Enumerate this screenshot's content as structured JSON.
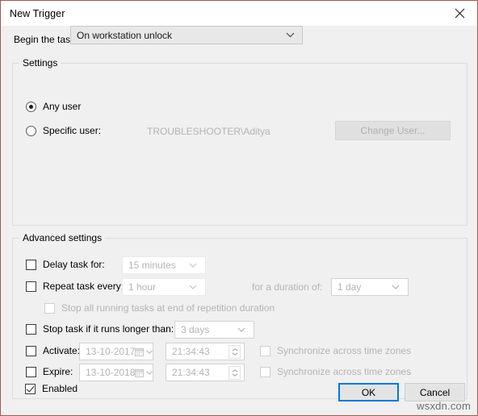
{
  "window": {
    "title": "New Trigger",
    "close_icon": "close-icon",
    "border_color": "#a3584f",
    "background": "#f0f0f0"
  },
  "begin": {
    "label": "Begin the task:",
    "value": "On workstation unlock",
    "chevron_icon": "chevron-down-icon"
  },
  "settings": {
    "legend": "Settings",
    "any_user": {
      "label": "Any user",
      "checked": true
    },
    "specific_user": {
      "label": "Specific user:",
      "checked": false,
      "value": "TROUBLESHOOTER\\Aditya"
    },
    "change_user_button": "Change User...",
    "change_user_enabled": false
  },
  "advanced": {
    "legend": "Advanced settings",
    "delay_task": {
      "label": "Delay task for:",
      "checked": false,
      "value": "15 minutes"
    },
    "repeat_task": {
      "label": "Repeat task every:",
      "checked": false,
      "value": "1 hour"
    },
    "duration": {
      "label": "for a duration of:",
      "value": "1 day"
    },
    "stop_all": {
      "label": "Stop all running tasks at end of repetition duration",
      "checked": false
    },
    "stop_task": {
      "label": "Stop task if it runs longer than:",
      "checked": false,
      "value": "3 days"
    },
    "activate": {
      "label": "Activate:",
      "checked": false,
      "date": "13-10-2017",
      "time": "21:34:43",
      "sync_label": "Synchronize across time zones",
      "sync_checked": false
    },
    "expire": {
      "label": "Expire:",
      "checked": false,
      "date": "13-10-2018",
      "time": "21:34:43",
      "sync_label": "Synchronize across time zones",
      "sync_checked": false
    },
    "enabled": {
      "label": "Enabled",
      "checked": true
    }
  },
  "buttons": {
    "ok": "OK",
    "cancel": "Cancel",
    "ok_focus_color": "#0078d7"
  },
  "watermark": "wsxdn.com"
}
